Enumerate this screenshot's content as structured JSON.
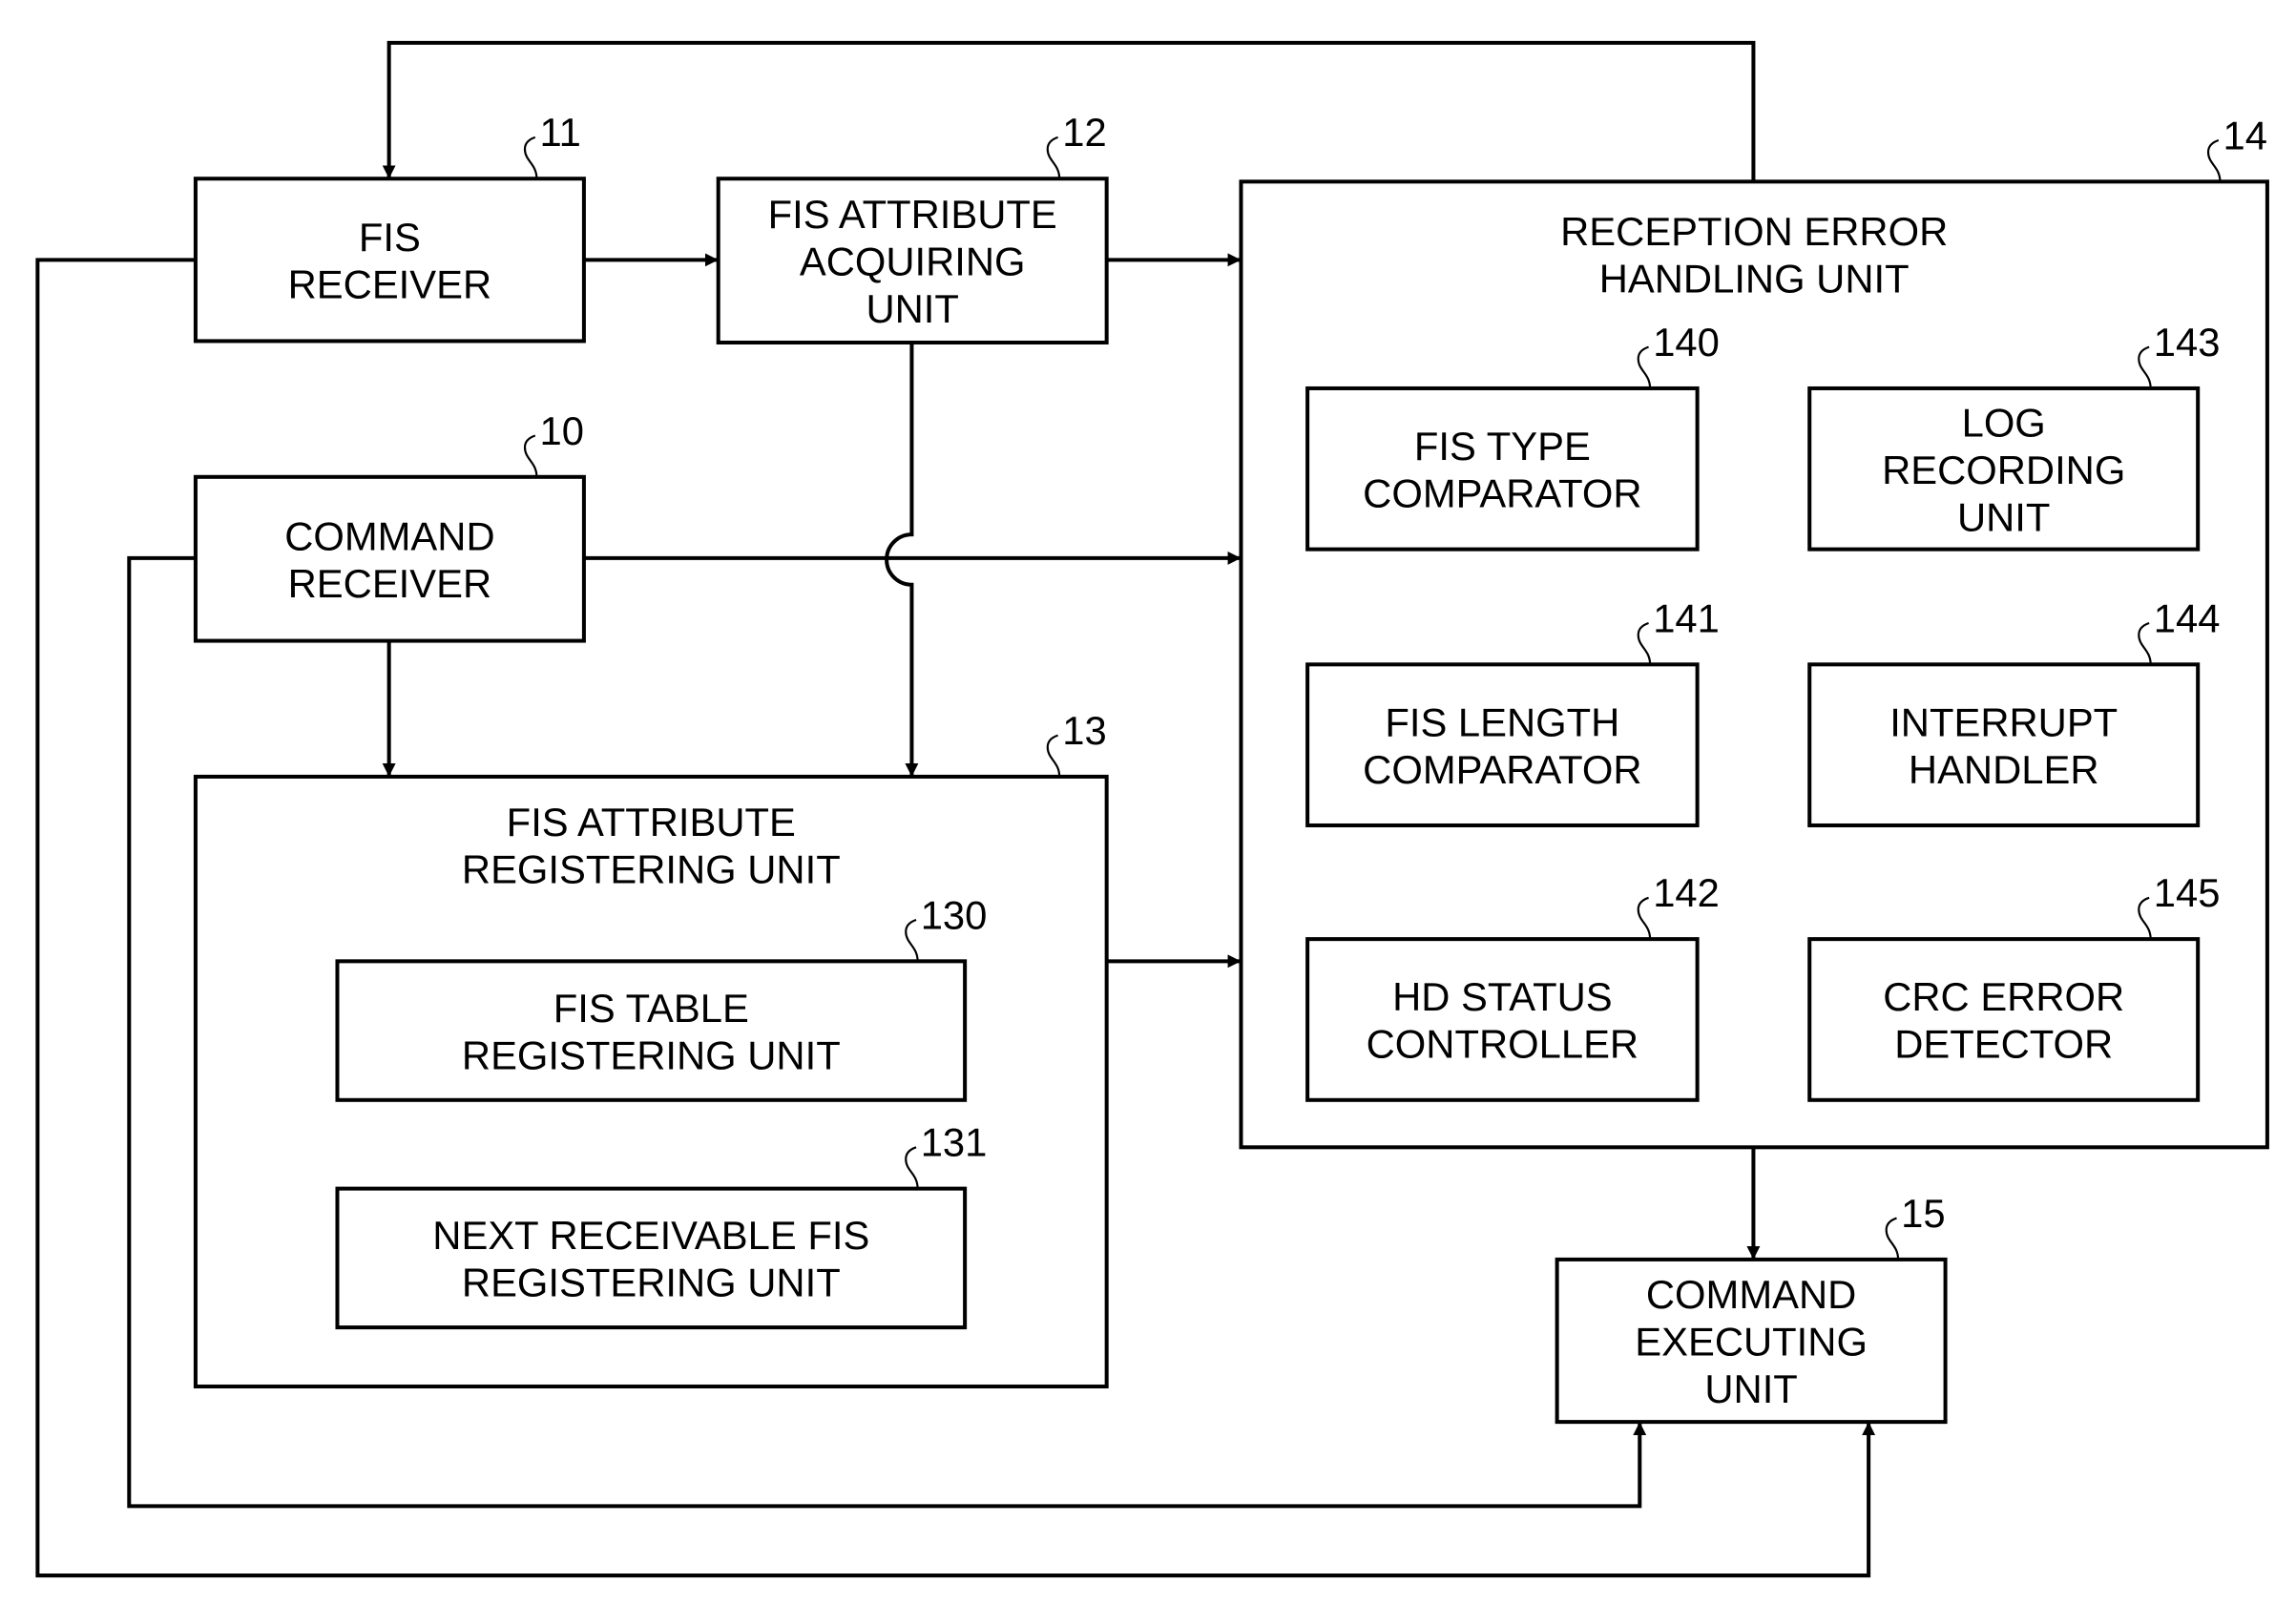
{
  "figure": {
    "blocks": [
      {
        "id": "11",
        "ref": "11",
        "lines": [
          "FIS",
          "RECEIVER"
        ]
      },
      {
        "id": "12",
        "ref": "12",
        "lines": [
          "FIS ATTRIBUTE",
          "ACQUIRING",
          "UNIT"
        ]
      },
      {
        "id": "10",
        "ref": "10",
        "lines": [
          "COMMAND",
          "RECEIVER"
        ]
      },
      {
        "id": "13",
        "ref": "13",
        "lines": [
          "FIS ATTRIBUTE",
          "REGISTERING UNIT"
        ]
      },
      {
        "id": "130",
        "ref": "130",
        "lines": [
          "FIS TABLE",
          "REGISTERING UNIT"
        ]
      },
      {
        "id": "131",
        "ref": "131",
        "lines": [
          "NEXT RECEIVABLE FIS",
          "REGISTERING UNIT"
        ]
      },
      {
        "id": "14",
        "ref": "14",
        "lines": [
          "RECEPTION ERROR",
          "HANDLING UNIT"
        ]
      },
      {
        "id": "140",
        "ref": "140",
        "lines": [
          "FIS TYPE",
          "COMPARATOR"
        ]
      },
      {
        "id": "141",
        "ref": "141",
        "lines": [
          "FIS LENGTH",
          "COMPARATOR"
        ]
      },
      {
        "id": "142",
        "ref": "142",
        "lines": [
          "HD STATUS",
          "CONTROLLER"
        ]
      },
      {
        "id": "143",
        "ref": "143",
        "lines": [
          "LOG",
          "RECORDING",
          "UNIT"
        ]
      },
      {
        "id": "144",
        "ref": "144",
        "lines": [
          "INTERRUPT",
          "HANDLER"
        ]
      },
      {
        "id": "145",
        "ref": "145",
        "lines": [
          "CRC ERROR",
          "DETECTOR"
        ]
      },
      {
        "id": "15",
        "ref": "15",
        "lines": [
          "COMMAND",
          "EXECUTING",
          "UNIT"
        ]
      }
    ],
    "connections": [
      {
        "from": "11",
        "to": "12"
      },
      {
        "from": "12",
        "to": "14"
      },
      {
        "from": "12",
        "to": "13"
      },
      {
        "from": "10",
        "to": "14"
      },
      {
        "from": "10",
        "to": "13"
      },
      {
        "from": "13",
        "to": "14"
      },
      {
        "from": "14",
        "to": "11"
      },
      {
        "from": "14",
        "to": "15"
      },
      {
        "from": "10",
        "to": "15"
      },
      {
        "from": "11",
        "to": "15"
      }
    ]
  }
}
